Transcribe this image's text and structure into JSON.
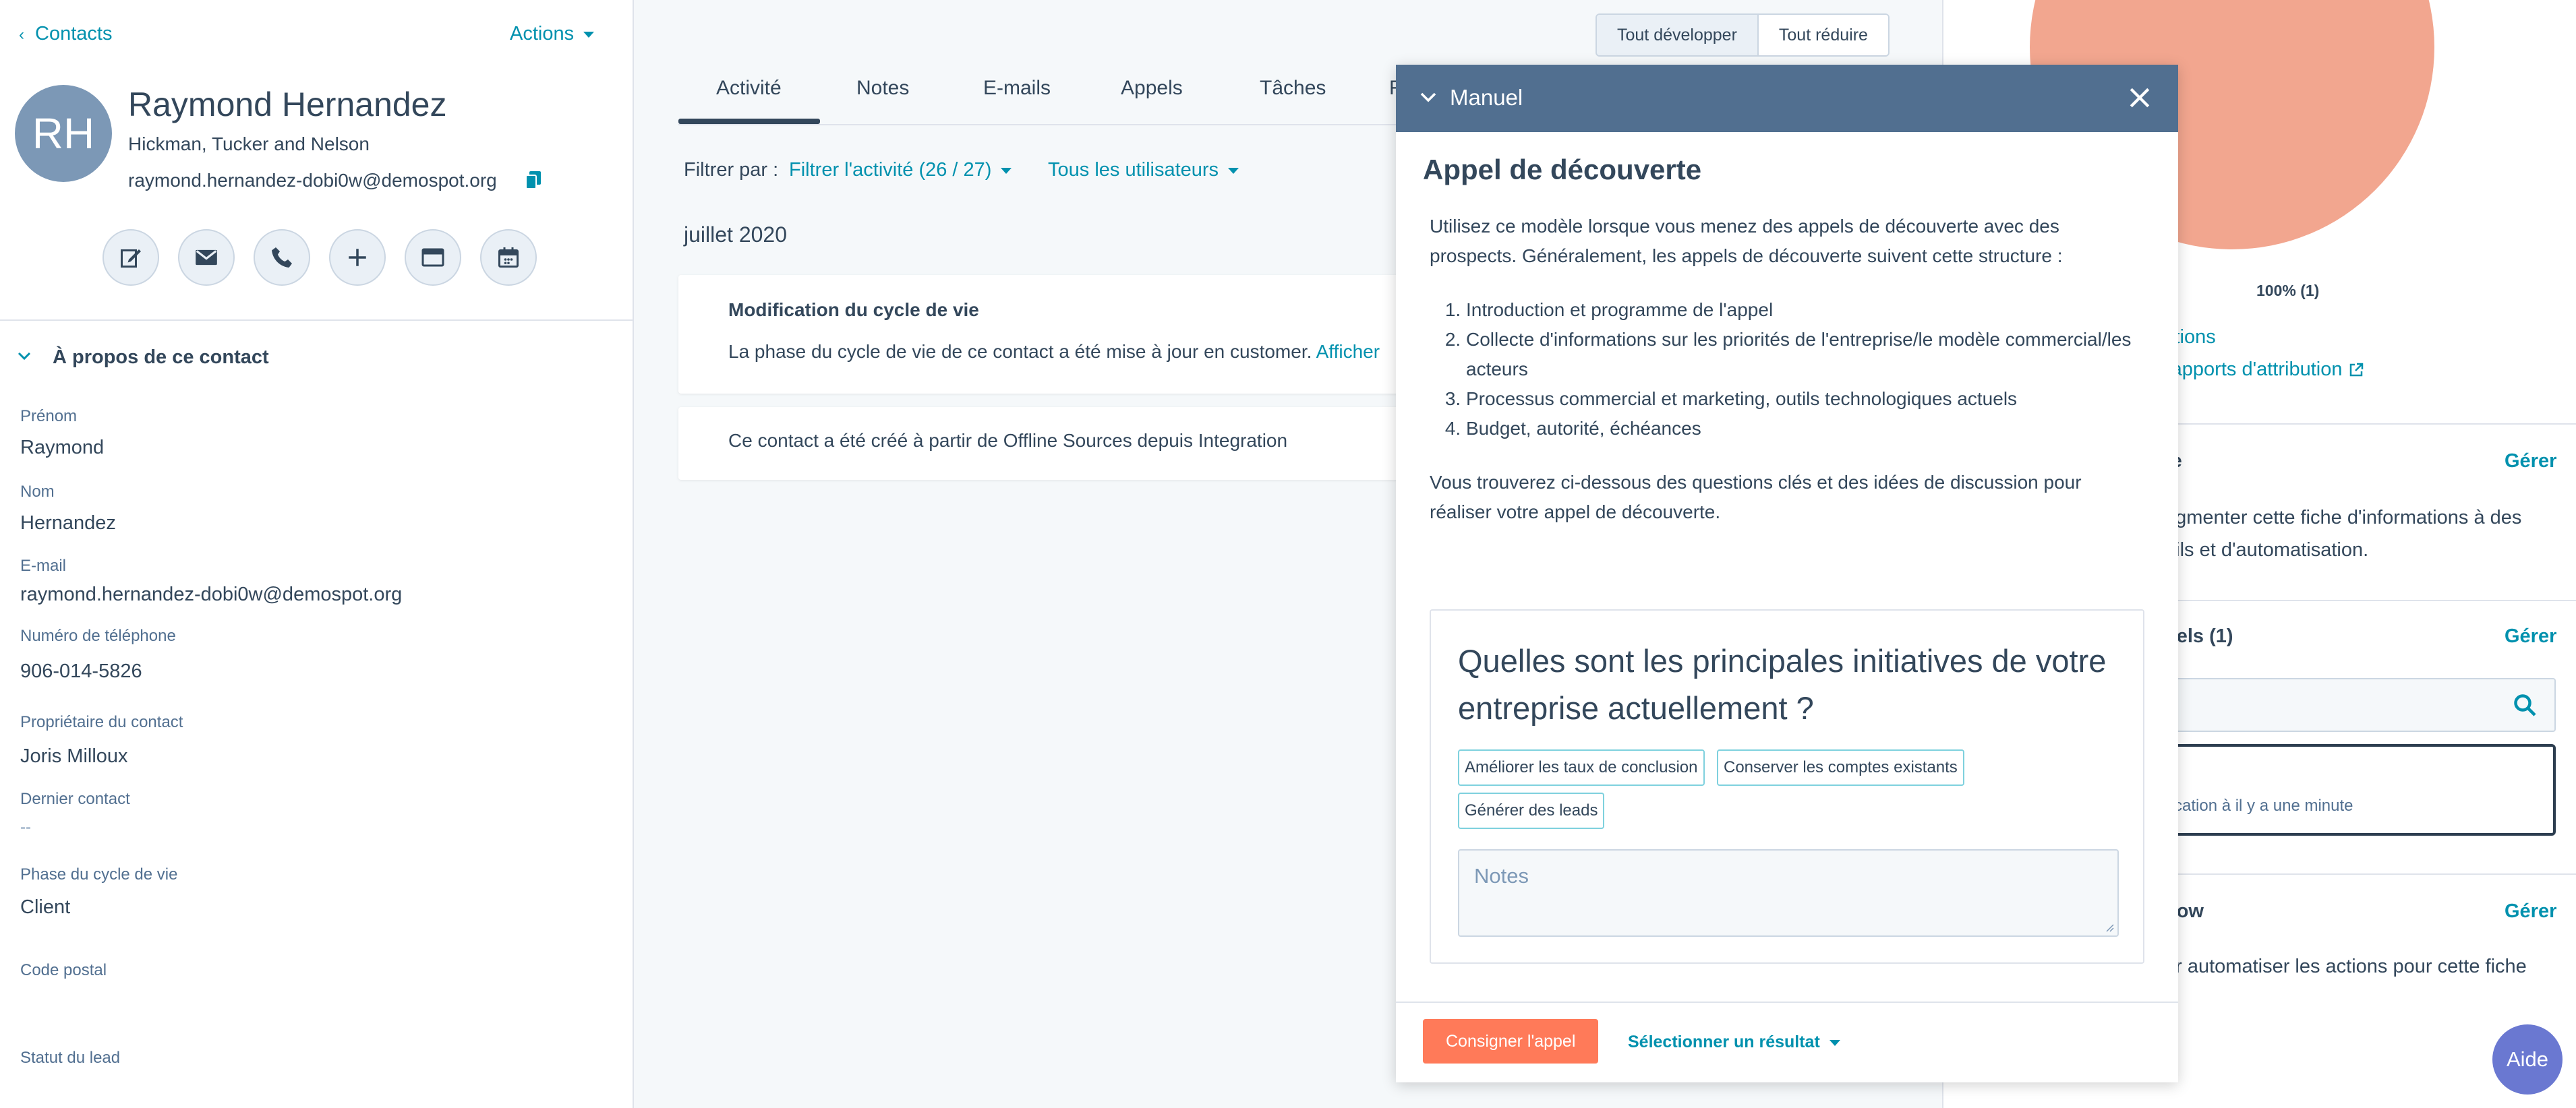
{
  "left": {
    "back_label": "Contacts",
    "actions_label": "Actions",
    "avatar_initials": "RH",
    "name": "Raymond Hernandez",
    "company": "Hickman, Tucker and Nelson",
    "email": "raymond.hernandez-dobi0w@demospot.org",
    "about_title": "À propos de ce contact",
    "props": [
      {
        "label": "Prénom",
        "value": "Raymond"
      },
      {
        "label": "Nom",
        "value": "Hernandez"
      },
      {
        "label": "E-mail",
        "value": "raymond.hernandez-dobi0w@demospot.org"
      },
      {
        "label": "Numéro de téléphone",
        "value": "906-014-5826"
      },
      {
        "label": "Propriétaire du contact",
        "value": "Joris Milloux"
      },
      {
        "label": "Dernier contact",
        "value": "--"
      },
      {
        "label": "Phase du cycle de vie",
        "value": "Client"
      },
      {
        "label": "Code postal",
        "value": ""
      },
      {
        "label": "Statut du lead",
        "value": ""
      }
    ]
  },
  "middle": {
    "expand_all": "Tout développer",
    "collapse_all": "Tout réduire",
    "tabs": [
      "Activité",
      "Notes",
      "E-mails",
      "Appels",
      "Tâches",
      "R"
    ],
    "filter_label": "Filtrer par :",
    "filter_activity": "Filtrer l'activité (26 / 27)",
    "filter_users": "Tous les utilisateurs",
    "month": "juillet 2020",
    "card1_title": "Modification du cycle de vie",
    "card1_body": "La phase du cycle de vie de ce contact a été mise à jour en customer.",
    "card1_link": "Afficher",
    "card2_body": "Ce contact a été créé à partir de Offline Sources depuis Integration"
  },
  "right": {
    "pie_label": "100% (1)",
    "link1": "ctions",
    "link2": "rapports d'attribution",
    "section1_title": "te",
    "section1_text": "egmenter cette fiche d'informations à des\nails et d'automatisation.",
    "section2_title": "nels (1)",
    "item_text": "cation à il y a une minute",
    "section3_title": "flow",
    "section3_text": "ur automatiser les actions pour cette fiche",
    "manage": "Gérer",
    "help": "Aide"
  },
  "modal": {
    "header": "Manuel",
    "title": "Appel de découverte",
    "intro": "Utilisez ce modèle lorsque vous menez des appels de découverte avec des prospects. Généralement, les appels de découverte suivent cette structure :",
    "list": [
      "Introduction et programme de l'appel",
      "Collecte d'informations sur les priorités de l'entreprise/le modèle commercial/les acteurs",
      "Processus commercial et marketing, outils technologiques actuels",
      "Budget, autorité, échéances"
    ],
    "outro": "Vous trouverez ci-dessous des questions clés et des idées de discussion pour réaliser votre appel de découverte.",
    "question": "Quelles sont les principales initiatives de votre entreprise actuellement ?",
    "chips": [
      "Améliorer les taux de conclusion",
      "Conserver les comptes existants",
      "Générer des leads"
    ],
    "notes_placeholder": "Notes",
    "log_button": "Consigner l'appel",
    "outcome": "Sélectionner un résultat"
  },
  "colors": {
    "link": "#0091ae",
    "primary_button": "#ff7a59",
    "modal_header": "#516f90",
    "pie": "#f2a68f",
    "help_button": "#6a78d1"
  }
}
